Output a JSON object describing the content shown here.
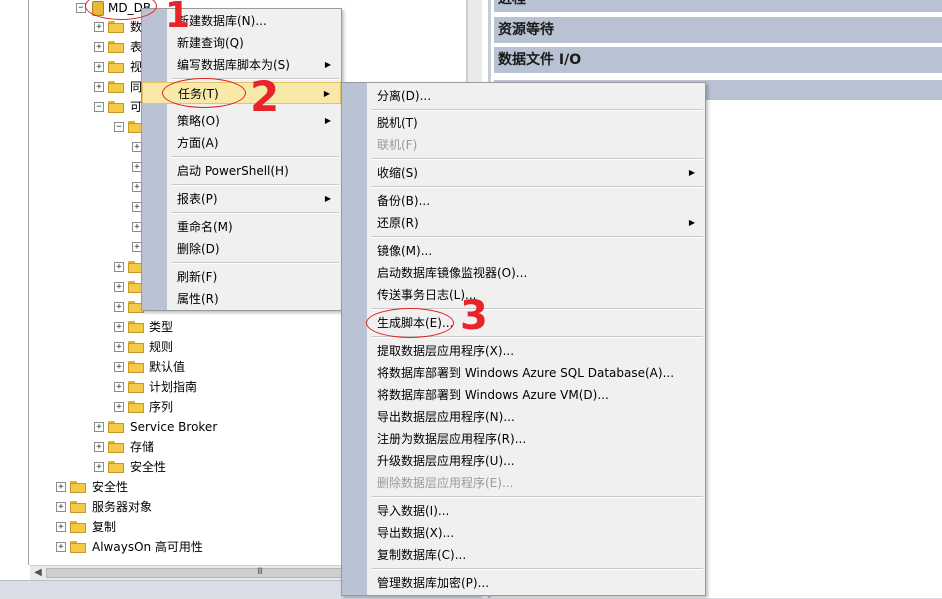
{
  "tree": {
    "db_name": "MD_DB",
    "children": [
      {
        "label": "数",
        "expander": "+"
      },
      {
        "label": "表",
        "expander": "+"
      },
      {
        "label": "视",
        "expander": "+"
      },
      {
        "label": "同",
        "expander": "+"
      },
      {
        "label": "可",
        "expander": "−"
      }
    ],
    "programmability_nodes": [
      {
        "label": "类型"
      },
      {
        "label": "规则"
      },
      {
        "label": "默认值"
      },
      {
        "label": "计划指南"
      },
      {
        "label": "序列"
      }
    ],
    "db_level_nodes": [
      {
        "label": "Service Broker"
      },
      {
        "label": "存储"
      },
      {
        "label": "安全性"
      }
    ],
    "server_level_nodes": [
      {
        "label": "安全性"
      },
      {
        "label": "服务器对象"
      },
      {
        "label": "复制"
      },
      {
        "label": "AlwaysOn 高可用性"
      }
    ],
    "scroll_grip": "III"
  },
  "right_panel": {
    "top_bar": "进程",
    "bars": [
      "资源等待",
      "数据文件 I/O"
    ]
  },
  "context_menu": {
    "items": [
      {
        "label": "新建数据库(N)..."
      },
      {
        "label": "新建查询(Q)"
      },
      {
        "label": "编写数据库脚本为(S)",
        "submenu": true
      },
      {
        "label": "任务(T)",
        "submenu": true,
        "highlighted": true
      },
      {
        "label": "策略(O)",
        "submenu": true
      },
      {
        "label": "方面(A)"
      },
      {
        "label": "启动 PowerShell(H)"
      },
      {
        "label": "报表(P)",
        "submenu": true
      },
      {
        "label": "重命名(M)"
      },
      {
        "label": "删除(D)"
      },
      {
        "label": "刷新(F)"
      },
      {
        "label": "属性(R)"
      }
    ]
  },
  "tasks_submenu": {
    "items": [
      {
        "label": "分离(D)..."
      },
      {
        "label": "脱机(T)"
      },
      {
        "label": "联机(F)",
        "disabled": true
      },
      {
        "label": "收缩(S)",
        "submenu": true
      },
      {
        "label": "备份(B)..."
      },
      {
        "label": "还原(R)",
        "submenu": true
      },
      {
        "label": "镜像(M)..."
      },
      {
        "label": "启动数据库镜像监视器(O)..."
      },
      {
        "label": "传送事务日志(L)..."
      },
      {
        "label": "生成脚本(E)..."
      },
      {
        "label": "提取数据层应用程序(X)..."
      },
      {
        "label": "将数据库部署到 Windows Azure SQL Database(A)..."
      },
      {
        "label": "将数据库部署到 Windows Azure VM(D)..."
      },
      {
        "label": "导出数据层应用程序(N)..."
      },
      {
        "label": "注册为数据层应用程序(R)..."
      },
      {
        "label": "升级数据层应用程序(U)..."
      },
      {
        "label": "删除数据层应用程序(E)...",
        "disabled": true
      },
      {
        "label": "导入数据(I)..."
      },
      {
        "label": "导出数据(X)..."
      },
      {
        "label": "复制数据库(C)..."
      },
      {
        "label": "管理数据库加密(P)..."
      }
    ]
  },
  "annotations": {
    "step1": "1",
    "step2": "2",
    "step3": "3"
  },
  "colors": {
    "annotation": "#e8232a",
    "menu_highlight": "#f8e9a8",
    "menu_gutter": "#b9c3d3",
    "report_bar": "#b8c2d2"
  }
}
